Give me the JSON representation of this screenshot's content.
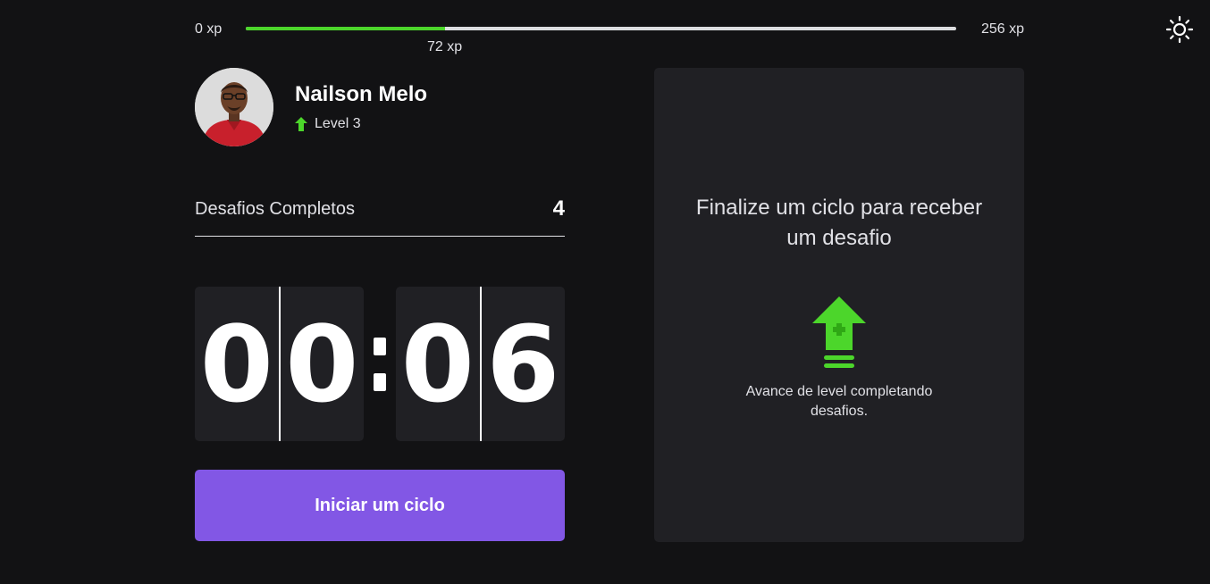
{
  "xp": {
    "min_label": "0 xp",
    "max_label": "256 xp",
    "current_label": "72 xp",
    "progress_fraction": 0.28,
    "fill_color": "#4cd62b"
  },
  "theme_toggle": {
    "icon": "sun-icon"
  },
  "profile": {
    "name": "Nailson Melo",
    "level_label": "Level 3",
    "level_icon": "level-up-arrow-icon"
  },
  "challenges_completed": {
    "label": "Desafios Completos",
    "count": "4"
  },
  "countdown": {
    "minute_tens": "0",
    "minute_ones": "0",
    "second_tens": "0",
    "second_ones": "6"
  },
  "start_button": {
    "label": "Iniciar um ciclo",
    "color": "#8257e5"
  },
  "challenge_panel": {
    "title": "Finalize um ciclo para receber um desafio",
    "icon": "level-up-icon",
    "description": "Avance de level completando desafios."
  }
}
